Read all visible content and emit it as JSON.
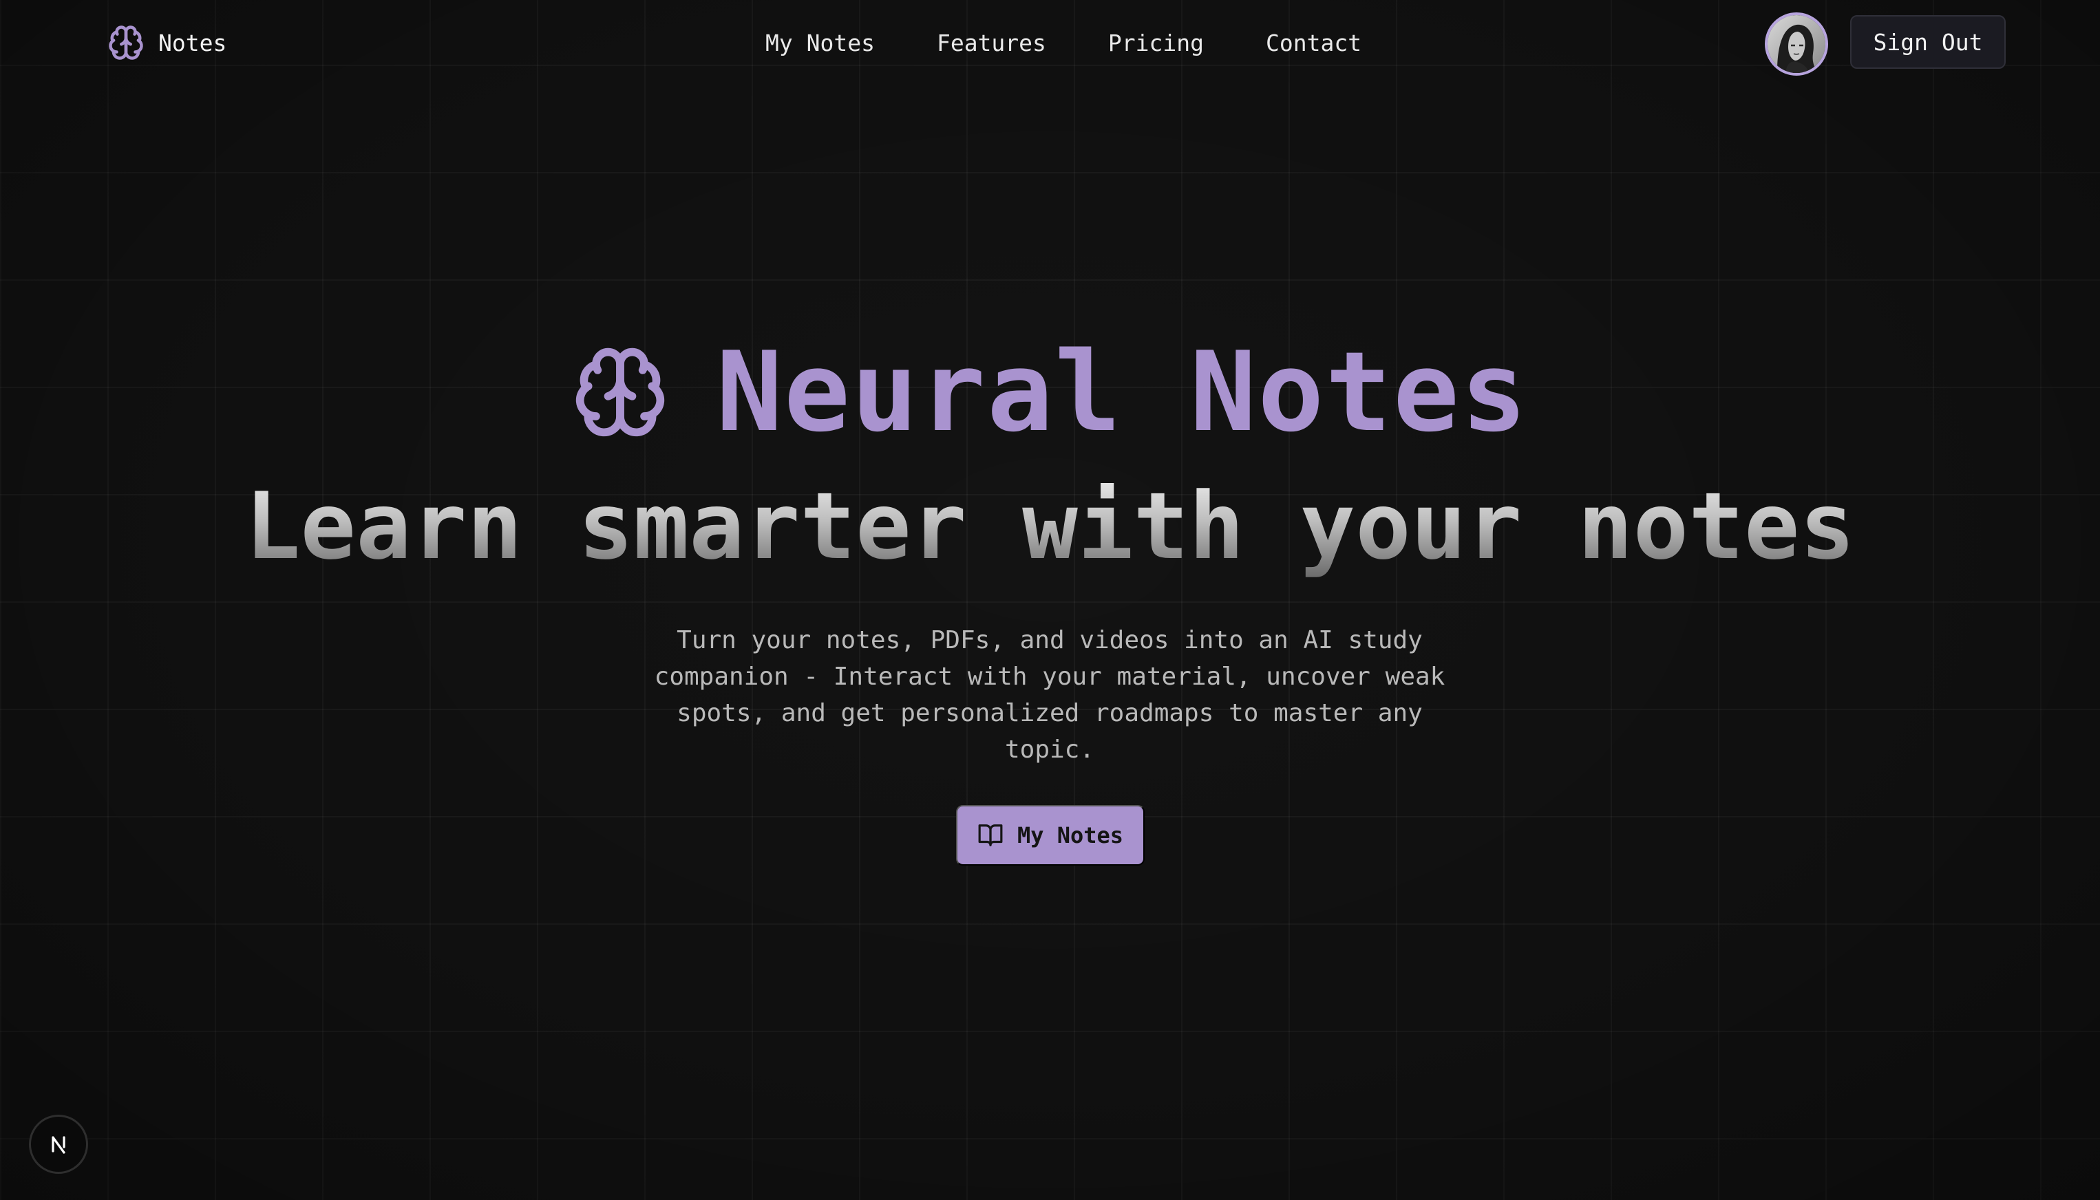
{
  "navbar": {
    "brand": {
      "label": "Notes",
      "icon": "brain-icon"
    },
    "links": [
      {
        "label": "My Notes"
      },
      {
        "label": "Features"
      },
      {
        "label": "Pricing"
      },
      {
        "label": "Contact"
      }
    ],
    "avatar": {
      "icon": "user-avatar"
    },
    "sign_out_label": "Sign Out"
  },
  "hero": {
    "title": "Neural Notes",
    "title_icon": "brain-icon",
    "tagline": "Learn smarter with your notes",
    "description": "Turn your notes, PDFs, and videos into an AI study companion - Interact with your material, uncover weak spots, and get personalized roadmaps to master any topic.",
    "cta": {
      "label": "My Notes",
      "icon": "book-open-icon"
    }
  },
  "badge": {
    "icon": "nextjs-logo-icon"
  },
  "colors": {
    "accent": "#a993cf",
    "background": "#131313",
    "button_dark": "#1b1b22"
  }
}
